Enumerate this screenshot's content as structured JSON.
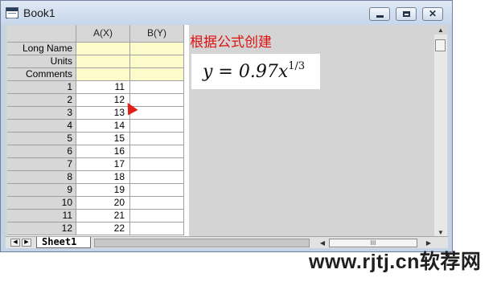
{
  "window": {
    "title": "Book1",
    "minimize_glyph": "",
    "maximize_glyph": "",
    "close_glyph": "✕"
  },
  "grid": {
    "columns": [
      "A(X)",
      "B(Y)"
    ],
    "meta_rows": [
      "Long Name",
      "Units",
      "Comments"
    ],
    "rows": [
      {
        "index": "1",
        "a": "11",
        "b": ""
      },
      {
        "index": "2",
        "a": "12",
        "b": ""
      },
      {
        "index": "3",
        "a": "13",
        "b": ""
      },
      {
        "index": "4",
        "a": "14",
        "b": ""
      },
      {
        "index": "5",
        "a": "15",
        "b": ""
      },
      {
        "index": "6",
        "a": "16",
        "b": ""
      },
      {
        "index": "7",
        "a": "17",
        "b": ""
      },
      {
        "index": "8",
        "a": "18",
        "b": ""
      },
      {
        "index": "9",
        "a": "19",
        "b": ""
      },
      {
        "index": "10",
        "a": "20",
        "b": ""
      },
      {
        "index": "11",
        "a": "21",
        "b": ""
      },
      {
        "index": "12",
        "a": "22",
        "b": ""
      }
    ]
  },
  "annotation": {
    "label": "根据公式创建",
    "formula_base": "y = 0.97x",
    "formula_exponent": "1/3",
    "color": "#e01010"
  },
  "sheet_tab": {
    "label": "Sheet1",
    "scroll_thumb_label": "III"
  },
  "watermark": "www.rjtj.cn软荐网"
}
